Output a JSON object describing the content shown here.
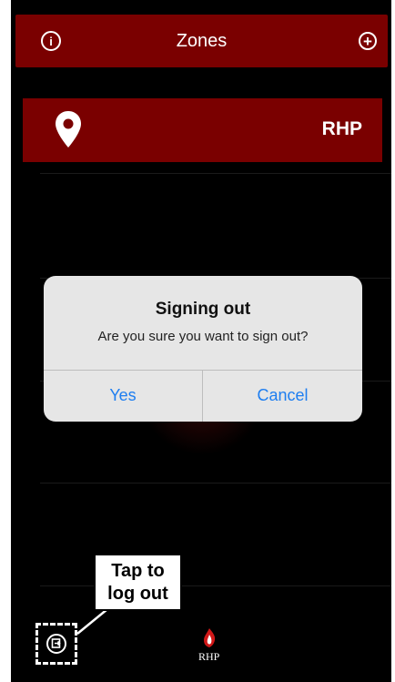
{
  "header": {
    "title": "Zones",
    "info_icon": "info-icon",
    "add_icon": "plus-icon"
  },
  "zones": [
    {
      "name": "RHP",
      "icon": "location-pin-icon"
    }
  ],
  "dialog": {
    "title": "Signing out",
    "message": "Are you sure you want to sign out?",
    "yes_label": "Yes",
    "cancel_label": "Cancel"
  },
  "annotation": {
    "line1": "Tap to",
    "line2": "log out"
  },
  "footer": {
    "logout_icon": "logout-icon",
    "brand_text": "RHP"
  },
  "colors": {
    "accent": "#7a0000",
    "dialog_button": "#1e7ef0",
    "background": "#000000"
  }
}
